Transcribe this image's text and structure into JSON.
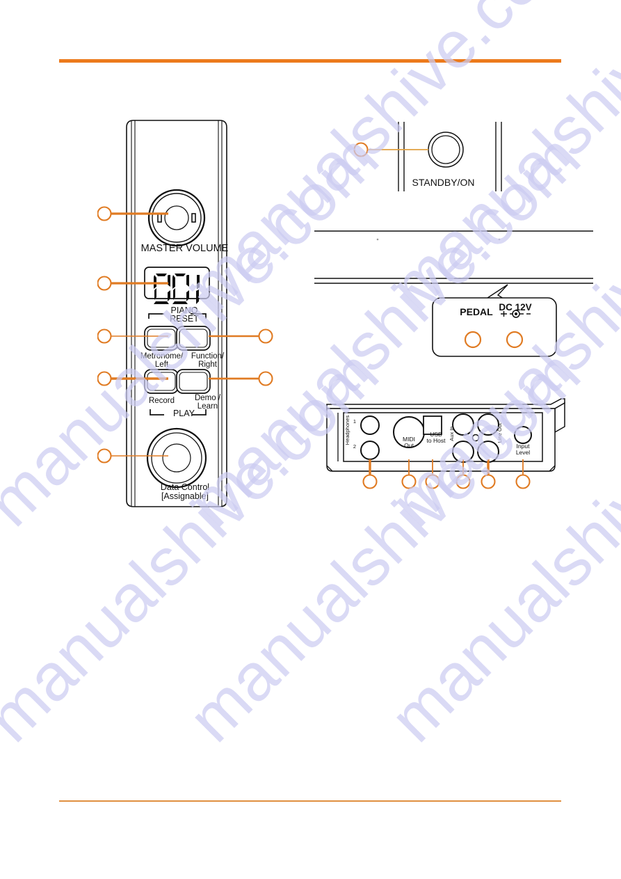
{
  "page": {
    "accent_rule_color": "#ec7a1c",
    "footer_rule_color": "#e09040",
    "callout_color": "#e07b23",
    "line_color": "#111111",
    "watermark_text": "manualshive.com"
  },
  "control_panel": {
    "name": "front-control-panel",
    "master_volume": {
      "label": "MASTER VOLUME",
      "callout": ""
    },
    "display": {
      "label": "001",
      "callout": ""
    },
    "piano_reset": {
      "line1": "PIANO",
      "line2": "RESET"
    },
    "buttons": [
      {
        "id": "metronome-left",
        "label": "Metronome/\nLeft",
        "callout": ""
      },
      {
        "id": "function-right",
        "label": "Function/\nRight",
        "callout": ""
      },
      {
        "id": "record",
        "label": "Record",
        "callout": ""
      },
      {
        "id": "demo-learn",
        "label": "Demo /\nLearn",
        "callout": ""
      }
    ],
    "play_bracket_label": "PLAY",
    "data_control": {
      "line1": "Data Control",
      "line2": "[Assignable]",
      "callout": ""
    }
  },
  "power_section": {
    "name": "standby-on-section",
    "label": "STANDBY/ON",
    "callout": ""
  },
  "pedal_section": {
    "name": "pedal-dc-jack-panel",
    "pedal_label": "PEDAL",
    "dc_label": "DC 12V",
    "dc_polarity": "+ -"
  },
  "rear_panel": {
    "name": "rear-connector-panel",
    "jacks": [
      {
        "id": "headphones",
        "label": "Headphones",
        "sub1": "1",
        "sub2": "2",
        "callout": ""
      },
      {
        "id": "midi-out",
        "label": "MIDI\nOut",
        "callout": ""
      },
      {
        "id": "usb-to-host",
        "label": "USB\nto Host",
        "callout": ""
      },
      {
        "id": "aux-in",
        "label": "Aux In",
        "callout": ""
      },
      {
        "id": "line-out",
        "label": "Line Out",
        "callout": ""
      },
      {
        "id": "input-level",
        "label": "Input\nLevel",
        "callout": ""
      }
    ]
  }
}
